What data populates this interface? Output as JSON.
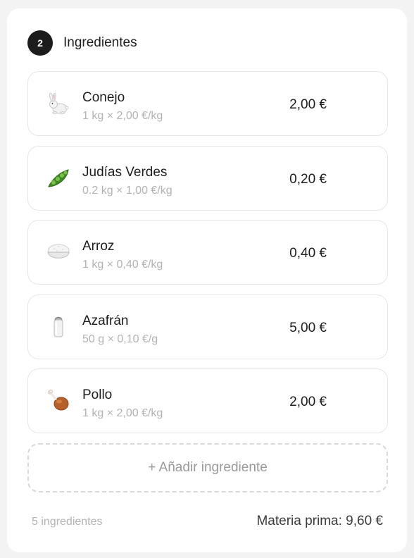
{
  "section": {
    "step": "2",
    "title": "Ingredientes"
  },
  "ingredients": [
    {
      "icon": "rabbit-icon",
      "name": "Conejo",
      "quantity": "1 kg × 2,00 €/kg",
      "price": "2,00 €"
    },
    {
      "icon": "pea-pod-icon",
      "name": "Judías Verdes",
      "quantity": "0.2 kg × 1,00 €/kg",
      "price": "0,20 €"
    },
    {
      "icon": "rice-bowl-icon",
      "name": "Arroz",
      "quantity": "1 kg × 0,40 €/kg",
      "price": "0,40 €"
    },
    {
      "icon": "salt-shaker-icon",
      "name": "Azafrán",
      "quantity": "50 g × 0,10 €/g",
      "price": "5,00 €"
    },
    {
      "icon": "chicken-leg-icon",
      "name": "Pollo",
      "quantity": "1 kg × 2,00 €/kg",
      "price": "2,00 €"
    }
  ],
  "add_button": {
    "label": "+ Añadir ingrediente"
  },
  "footer": {
    "count": "5 ingredientes",
    "total": "Materia prima: 9,60 €"
  }
}
